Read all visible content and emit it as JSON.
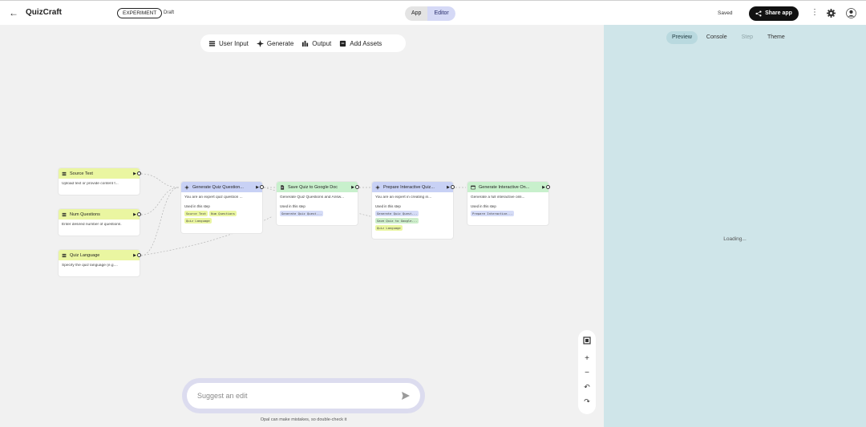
{
  "header": {
    "app_title": "QuizCraft",
    "experiment_badge": "EXPERIMENT",
    "status": "Draft",
    "mode_app": "App",
    "mode_editor": "Editor",
    "saved": "Saved",
    "share_label": "Share app"
  },
  "toolbar": {
    "user_input": "User Input",
    "generate": "Generate",
    "output": "Output",
    "add_assets": "Add Assets"
  },
  "nodes": {
    "source_text": {
      "title": "Source Text",
      "desc": "Upload text or provide content f..."
    },
    "num_questions": {
      "title": "Num Questions",
      "desc": "Enter desired number of questions."
    },
    "quiz_language": {
      "title": "Quiz Language",
      "desc": "Specify the quiz language (e.g...."
    },
    "generate_quiz": {
      "title": "Generate Quiz Question...",
      "desc": "You are an expert quiz question ...",
      "used": "Used in this step",
      "chips": [
        "Source Text",
        "Num Questions",
        "Quiz Language"
      ]
    },
    "save_quiz": {
      "title": "Save Quiz to Google Doc",
      "desc": "Generate Quiz Questions and Answ...",
      "used": "Used in this step",
      "chips": [
        "Generate Quiz Quest..."
      ]
    },
    "prepare_quiz": {
      "title": "Prepare Interactive Quiz...",
      "desc": "You are an expert in creating in...",
      "used": "Used in this step",
      "chips": [
        "Generate Quiz Quest...",
        "Save Quiz to Google...",
        "Quiz Language"
      ]
    },
    "generate_online": {
      "title": "Generate Interactive On...",
      "desc": "Generate a full interactive onli...",
      "used": "Used in this step",
      "chips": [
        "Prepare Interactive..."
      ]
    }
  },
  "right_panel": {
    "tabs": [
      "Preview",
      "Console",
      "Step",
      "Theme"
    ],
    "loading": "Loading..."
  },
  "suggest": {
    "placeholder": "Suggest an edit",
    "disclaimer": "Opal can make mistakes, so double-check it"
  },
  "colors": {
    "input_node": "#eaf6a1",
    "generate_node": "#c8d1f5",
    "output_node": "#c8f0cc",
    "panel_bg": "#cfe5e9",
    "editor_active": "#d5d9f6"
  }
}
